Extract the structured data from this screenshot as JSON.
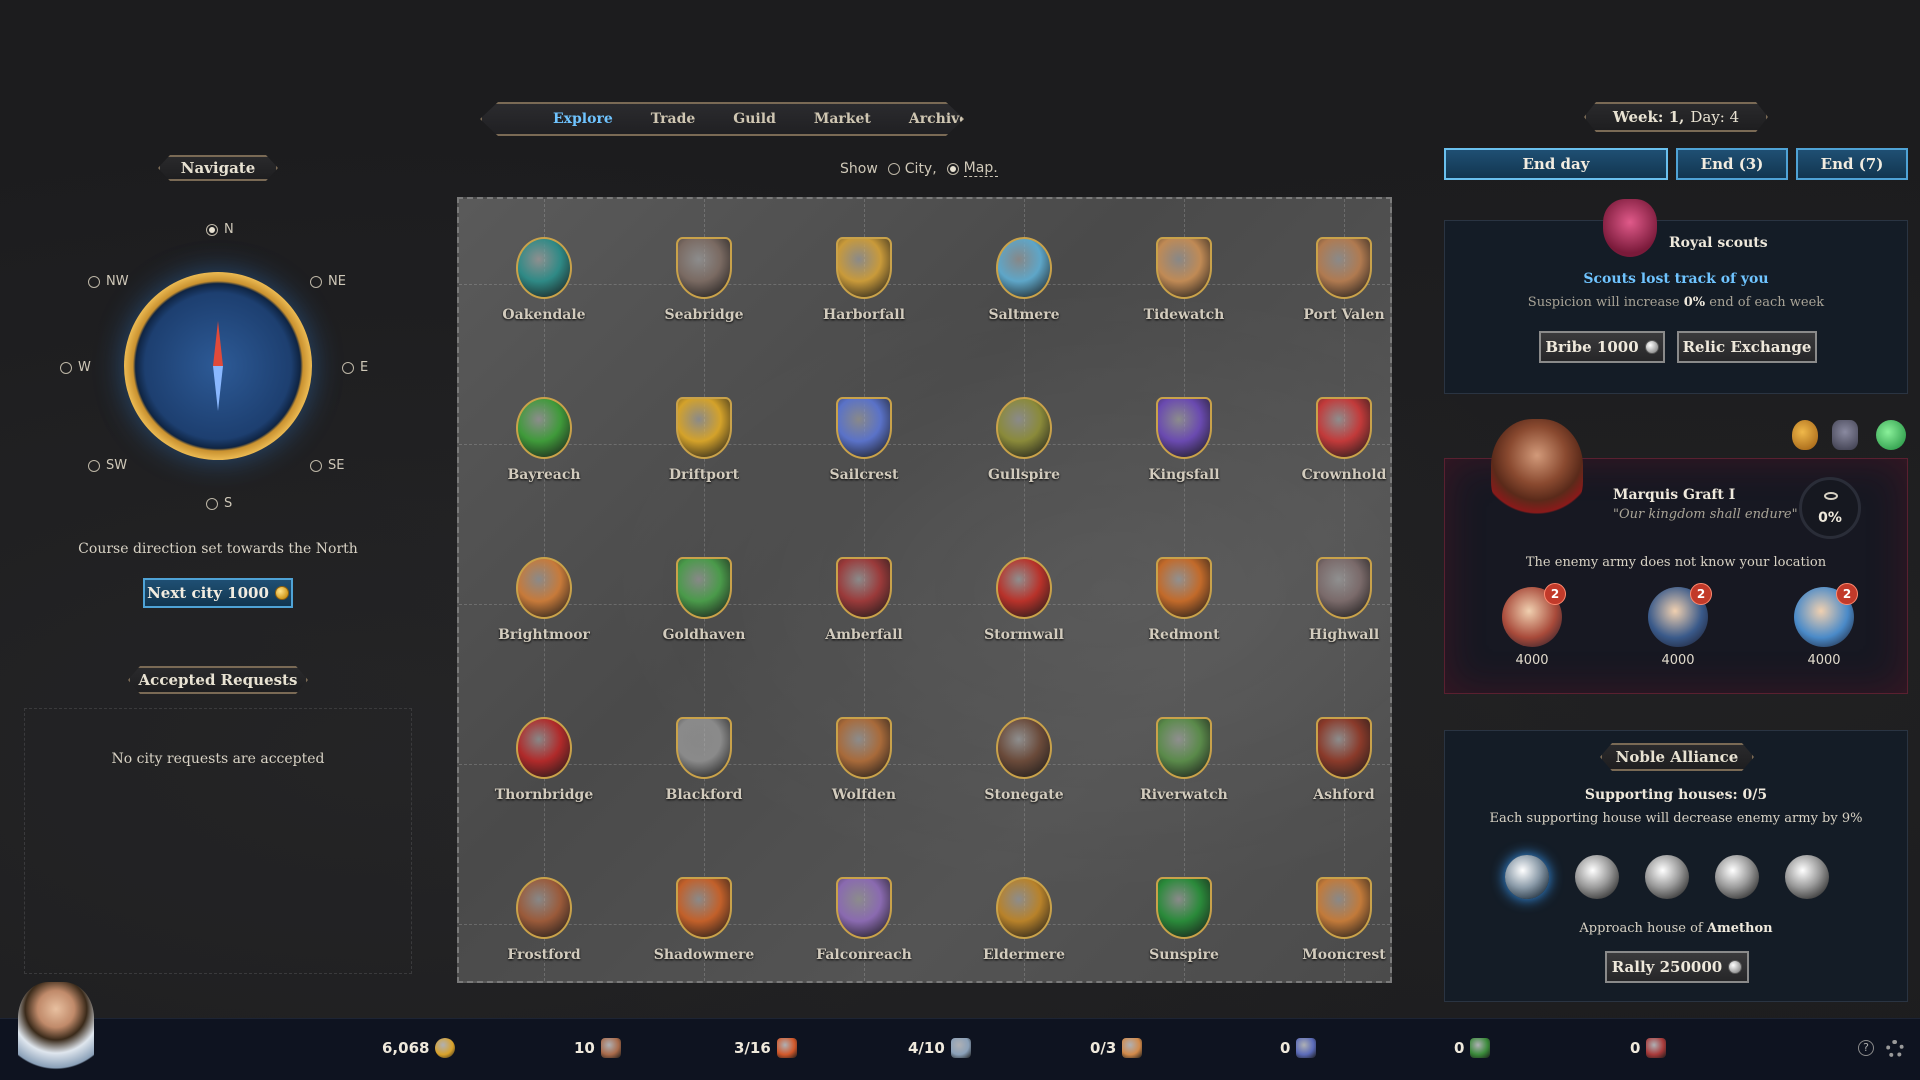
{
  "tabs": [
    "Explore",
    "Trade",
    "Guild",
    "Market",
    "Archive"
  ],
  "active_tab": "Explore",
  "show": {
    "label": "Show",
    "city": "City,",
    "map": "Map."
  },
  "left": {
    "navigate_label": "Navigate",
    "directions": {
      "n": "N",
      "ne": "NE",
      "e": "E",
      "se": "SE",
      "s": "S",
      "sw": "SW",
      "w": "W",
      "nw": "NW"
    },
    "course_text": "Course direction set towards the North",
    "next_city_label": "Next city 1000",
    "accepted_label": "Accepted Requests",
    "no_requests": "No city requests are accepted"
  },
  "cities": [
    {
      "name": "Oakendale",
      "color": "#2f8a86"
    },
    {
      "name": "Seabridge",
      "color": "#7a6a62"
    },
    {
      "name": "Harborfall",
      "color": "#c99a3a"
    },
    {
      "name": "Saltmere",
      "color": "#5ea6c8"
    },
    {
      "name": "Tidewatch",
      "color": "#c08a55"
    },
    {
      "name": "Port Valen",
      "color": "#b07a50"
    },
    {
      "name": "Bayreach",
      "color": "#3f9a3a"
    },
    {
      "name": "Driftport",
      "color": "#d4a22a"
    },
    {
      "name": "Sailcrest",
      "color": "#5a72c8"
    },
    {
      "name": "Gullspire",
      "color": "#8a8a3a"
    },
    {
      "name": "Kingsfall",
      "color": "#6a4ab0"
    },
    {
      "name": "Crownhold",
      "color": "#c23a3a"
    },
    {
      "name": "Brightmoor",
      "color": "#c77a3a"
    },
    {
      "name": "Goldhaven",
      "color": "#4a9a4a"
    },
    {
      "name": "Amberfall",
      "color": "#9a3a3a"
    },
    {
      "name": "Stormwall",
      "color": "#b8322a"
    },
    {
      "name": "Redmont",
      "color": "#c26a2a"
    },
    {
      "name": "Highwall",
      "color": "#7a6a6a"
    },
    {
      "name": "Thornbridge",
      "color": "#b02a2a"
    },
    {
      "name": "Blackford",
      "color": "#8a8a8a"
    },
    {
      "name": "Wolfden",
      "color": "#a86a3a"
    },
    {
      "name": "Stonegate",
      "color": "#6a4a3a"
    },
    {
      "name": "Riverwatch",
      "color": "#5a8a4a"
    },
    {
      "name": "Ashford",
      "color": "#8a3a2a"
    },
    {
      "name": "Frostford",
      "color": "#9a5a3a"
    },
    {
      "name": "Shadowmere",
      "color": "#c2602a"
    },
    {
      "name": "Falconreach",
      "color": "#8a6ab0"
    },
    {
      "name": "Eldermere",
      "color": "#b8822a"
    },
    {
      "name": "Sunspire",
      "color": "#2a8a3a"
    },
    {
      "name": "Mooncrest",
      "color": "#c27a3a"
    }
  ],
  "right": {
    "week_label": "Week: 1,",
    "day_label": "Day: 4",
    "end_day": "End day",
    "end3": "End (3)",
    "end7": "End (7)",
    "scouts_title": "Royal scouts",
    "scouts_status": "Scouts lost track of you",
    "suspicion_a": "Suspicion will increase",
    "suspicion_pct": "0%",
    "suspicion_b": "end of each week",
    "bribe": "Bribe 1000",
    "relic": "Relic Exchange",
    "marquis_name": "Marquis Graft I",
    "marquis_quote": "\"Our kingdom shall endure\"",
    "detection_pct": "0%",
    "army_status": "The enemy army does not know your location",
    "units": [
      {
        "value": "4000",
        "badge": "2",
        "color": "#a84a3a"
      },
      {
        "value": "4000",
        "badge": "2",
        "color": "#3a5a8a"
      },
      {
        "value": "4000",
        "badge": "2",
        "color": "#4a8ac8"
      }
    ],
    "alliance_title": "Noble Alliance",
    "supporting": "Supporting houses: 0/5",
    "alliance_desc": "Each supporting house will decrease enemy army by 9%",
    "approach_a": "Approach house of",
    "approach_house": "Amethon",
    "rally": "Rally 250000"
  },
  "resources": [
    {
      "value": "6,068",
      "icon": "gold-coin-icon",
      "color": "#d9a22a"
    },
    {
      "value": "10",
      "icon": "crew-icon",
      "color": "#a86a4a"
    },
    {
      "value": "3/16",
      "icon": "cargo-crate-icon",
      "color": "#d2582a"
    },
    {
      "value": "4/10",
      "icon": "map-scroll-icon",
      "color": "#8aa0b8"
    },
    {
      "value": "0/3",
      "icon": "key-icon",
      "color": "#d28a4a"
    },
    {
      "value": "0",
      "icon": "crossed-swords-icon",
      "color": "#5a6ab8"
    },
    {
      "value": "0",
      "icon": "herb-icon",
      "color": "#3a8a3a"
    },
    {
      "value": "0",
      "icon": "ore-icon",
      "color": "#a83a3a"
    }
  ]
}
